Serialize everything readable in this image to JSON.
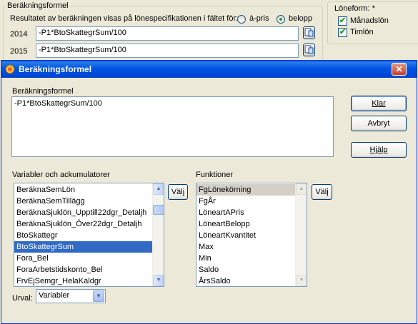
{
  "background": {
    "group_title": "Beräkningsformel",
    "result_label": "Resultatet av beräkningen visas på lönespecifikationen i fältet för:",
    "radio_apris": "à-pris",
    "radio_belopp": "belopp",
    "rows": [
      {
        "year": "2014",
        "formula": "-P1*BtoSkattegrSum/100"
      },
      {
        "year": "2015",
        "formula": "-P1*BtoSkattegrSum/100"
      }
    ],
    "loneform": {
      "title": "Löneform: *",
      "options": [
        {
          "label": "Månadslön",
          "checked": true
        },
        {
          "label": "Timlön",
          "checked": true
        }
      ]
    }
  },
  "dialog": {
    "title": "Beräkningsformel",
    "formula_label": "Beräkningsformel",
    "formula_value": "-P1*BtoSkattegrSum/100",
    "buttons": {
      "klar": "Klar",
      "avbryt": "Avbryt",
      "hjalp": "Hjälp"
    },
    "variables": {
      "label": "Variabler och ackumulatorer",
      "items": [
        "BeräknaSemLön",
        "BeräknaSemTillägg",
        "BeräknaSjuklön_Upptill22dgr_Detaljh",
        "BeräknaSjuklön_Över22dgr_Detaljh",
        "BtoSkattegr",
        "BtoSkattegrSum",
        "Fora_Bel",
        "ForaArbetstidskonto_Bel",
        "FrvEjSemgr_HelaKaldgr"
      ],
      "selected_index": 5,
      "choose_button": "Välj"
    },
    "functions": {
      "label": "Funktioner",
      "items": [
        "FgLönekörning",
        "FgÅr",
        "LöneartAPris",
        "LöneartBelopp",
        "LöneartKvantitet",
        "Max",
        "Min",
        "Saldo",
        "ÅrsSaldo"
      ],
      "highlighted_index": 0,
      "choose_button": "Välj"
    },
    "urval": {
      "label": "Urval:",
      "value": "Variabler"
    }
  },
  "colors": {
    "titlebar": "#0054e3",
    "selection": "#316ac5",
    "window": "#ece9d8"
  }
}
